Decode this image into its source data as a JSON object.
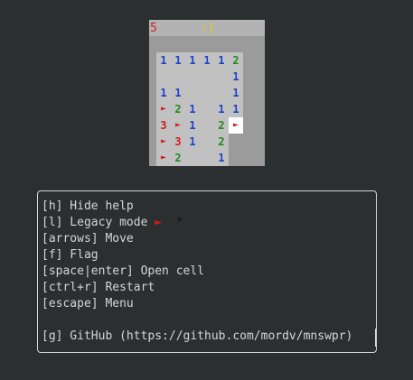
{
  "status_bar": {
    "mines_left": "5",
    "face": ":)"
  },
  "board": {
    "cells": [
      {
        "text": "1",
        "kind": "n1",
        "r": 0,
        "c": 0
      },
      {
        "text": "1",
        "kind": "n1",
        "r": 0,
        "c": 1
      },
      {
        "text": "1",
        "kind": "n1",
        "r": 0,
        "c": 2
      },
      {
        "text": "1",
        "kind": "n1",
        "r": 0,
        "c": 3
      },
      {
        "text": "1",
        "kind": "n1",
        "r": 0,
        "c": 4
      },
      {
        "text": "2",
        "kind": "n2",
        "r": 0,
        "c": 5
      },
      {
        "text": "",
        "kind": "blank",
        "r": 1,
        "c": 0
      },
      {
        "text": "",
        "kind": "blank",
        "r": 1,
        "c": 1
      },
      {
        "text": "",
        "kind": "blank",
        "r": 1,
        "c": 2
      },
      {
        "text": "",
        "kind": "blank",
        "r": 1,
        "c": 3
      },
      {
        "text": "",
        "kind": "blank",
        "r": 1,
        "c": 4
      },
      {
        "text": "1",
        "kind": "n1",
        "r": 1,
        "c": 5
      },
      {
        "text": "1",
        "kind": "n1",
        "r": 2,
        "c": 0
      },
      {
        "text": "1",
        "kind": "n1",
        "r": 2,
        "c": 1
      },
      {
        "text": "",
        "kind": "blank",
        "r": 2,
        "c": 2
      },
      {
        "text": "",
        "kind": "blank",
        "r": 2,
        "c": 3
      },
      {
        "text": "",
        "kind": "blank",
        "r": 2,
        "c": 4
      },
      {
        "text": "1",
        "kind": "n1",
        "r": 2,
        "c": 5
      },
      {
        "text": "►",
        "kind": "flag",
        "r": 3,
        "c": 0
      },
      {
        "text": "2",
        "kind": "n2",
        "r": 3,
        "c": 1
      },
      {
        "text": "1",
        "kind": "n1",
        "r": 3,
        "c": 2
      },
      {
        "text": "",
        "kind": "blank",
        "r": 3,
        "c": 3
      },
      {
        "text": "1",
        "kind": "n1",
        "r": 3,
        "c": 4
      },
      {
        "text": "1",
        "kind": "n1",
        "r": 3,
        "c": 5
      },
      {
        "text": "3",
        "kind": "n3",
        "r": 4,
        "c": 0
      },
      {
        "text": "►",
        "kind": "flag",
        "r": 4,
        "c": 1
      },
      {
        "text": "1",
        "kind": "n1",
        "r": 4,
        "c": 2
      },
      {
        "text": "",
        "kind": "blank",
        "r": 4,
        "c": 3
      },
      {
        "text": "2",
        "kind": "n2",
        "r": 4,
        "c": 4
      },
      {
        "text": "►",
        "kind": "flag-selected",
        "r": 4,
        "c": 5
      },
      {
        "text": "►",
        "kind": "flag",
        "r": 5,
        "c": 0
      },
      {
        "text": "3",
        "kind": "n3",
        "r": 5,
        "c": 1
      },
      {
        "text": "1",
        "kind": "n1",
        "r": 5,
        "c": 2
      },
      {
        "text": "",
        "kind": "blank",
        "r": 5,
        "c": 3
      },
      {
        "text": "2",
        "kind": "n2",
        "r": 5,
        "c": 4
      },
      {
        "text": "►",
        "kind": "flag",
        "r": 6,
        "c": 0
      },
      {
        "text": "2",
        "kind": "n2",
        "r": 6,
        "c": 1
      },
      {
        "text": "",
        "kind": "blank",
        "r": 6,
        "c": 2
      },
      {
        "text": "",
        "kind": "blank",
        "r": 6,
        "c": 3
      },
      {
        "text": "1",
        "kind": "n1",
        "r": 6,
        "c": 4
      }
    ]
  },
  "help": {
    "hide": "[h] Hide help",
    "legacy": "[l] Legacy mode",
    "legacy_flag": "►",
    "legacy_mine": "*",
    "move": "[arrows] Move",
    "flag": "[f] Flag",
    "open": "[space|enter] Open cell",
    "restart": "[ctrl+r] Restart",
    "menu": "[escape] Menu",
    "github": "[g] GitHub (https://github.com/mordv/mnswpr)"
  },
  "colors": {
    "n1": "#1a43c8",
    "n2": "#1e8a1e",
    "n3": "#d41b1b",
    "flag": "#d41b1b"
  }
}
